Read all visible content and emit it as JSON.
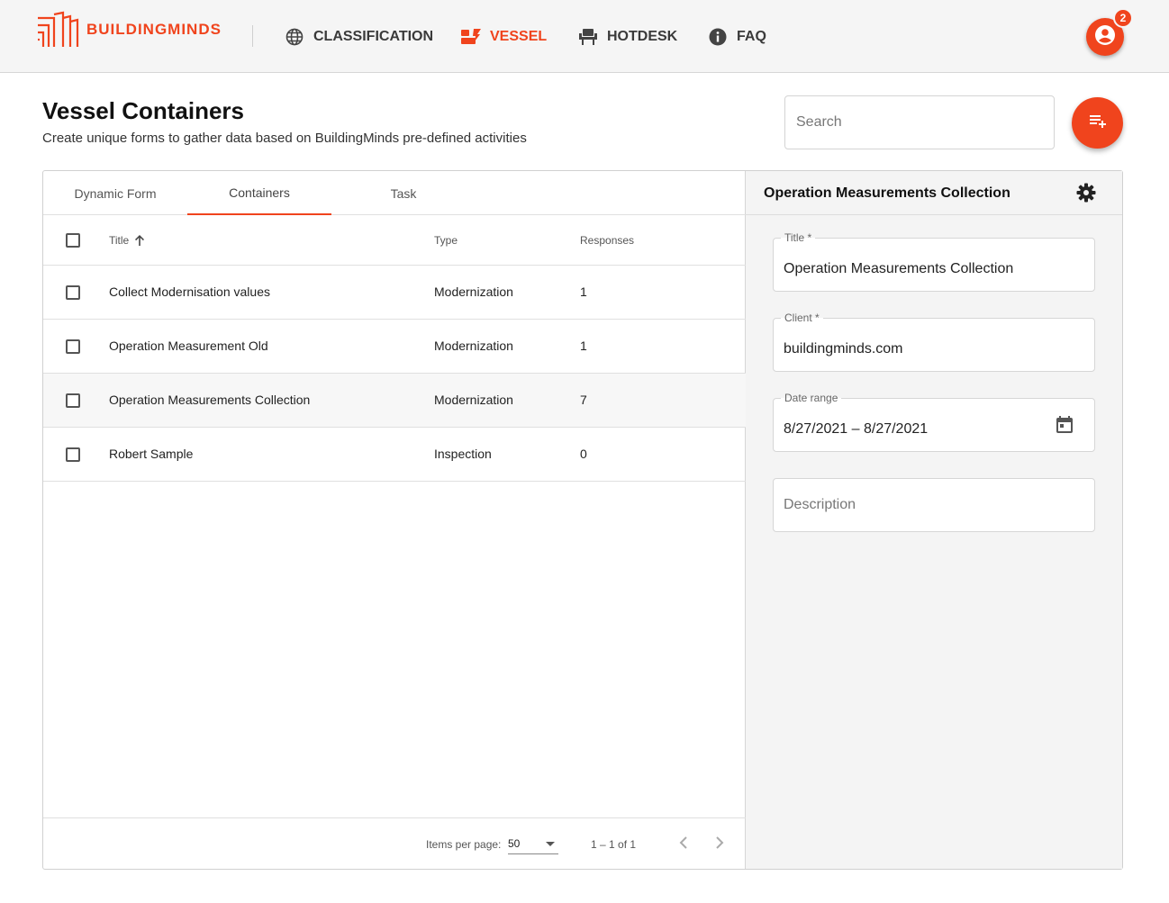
{
  "brand": {
    "name": "BUILDINGMINDS",
    "accent": "#f0441d"
  },
  "nav": [
    {
      "label": "CLASSIFICATION",
      "icon": "globe-icon",
      "active": false
    },
    {
      "label": "VESSEL",
      "icon": "vessel-icon",
      "active": true
    },
    {
      "label": "HOTDESK",
      "icon": "chair-icon",
      "active": false
    },
    {
      "label": "FAQ",
      "icon": "info-icon",
      "active": false
    }
  ],
  "user": {
    "icon": "account-circle-icon",
    "notifications": "2"
  },
  "page": {
    "title": "Vessel Containers",
    "subtitle": "Create unique forms to gather data based on BuildingMinds pre-defined activities",
    "search_placeholder": "Search",
    "add_icon": "playlist-add-icon"
  },
  "tabs": [
    {
      "label": "Dynamic Form",
      "active": false
    },
    {
      "label": "Containers",
      "active": true
    },
    {
      "label": "Task",
      "active": false
    }
  ],
  "table": {
    "columns": {
      "title": "Title",
      "type": "Type",
      "responses": "Responses"
    },
    "sort": {
      "column": "Title",
      "direction": "ascending",
      "icon": "arrow-up-icon"
    },
    "rows": [
      {
        "title": "Collect Modernisation values",
        "type": "Modernization",
        "responses": "1"
      },
      {
        "title": "Operation Measurement Old",
        "type": "Modernization",
        "responses": "1"
      },
      {
        "title": "Operation Measurements Collection",
        "type": "Modernization",
        "responses": "7"
      },
      {
        "title": "Robert Sample",
        "type": "Inspection",
        "responses": "0"
      }
    ]
  },
  "paginator": {
    "items_per_page_label": "Items per page:",
    "items_per_page": "50",
    "range": "1 – 1 of 1"
  },
  "detail": {
    "header": "Operation Measurements Collection",
    "settings_icon": "gear-icon",
    "fields": {
      "title": {
        "label": "Title *",
        "value": "Operation Measurements Collection"
      },
      "client": {
        "label": "Client *",
        "value": "buildingminds.com"
      },
      "date_range": {
        "label": "Date range",
        "value": "8/27/2021 – 8/27/2021",
        "icon": "calendar-icon"
      },
      "description": {
        "placeholder": "Description"
      }
    }
  }
}
